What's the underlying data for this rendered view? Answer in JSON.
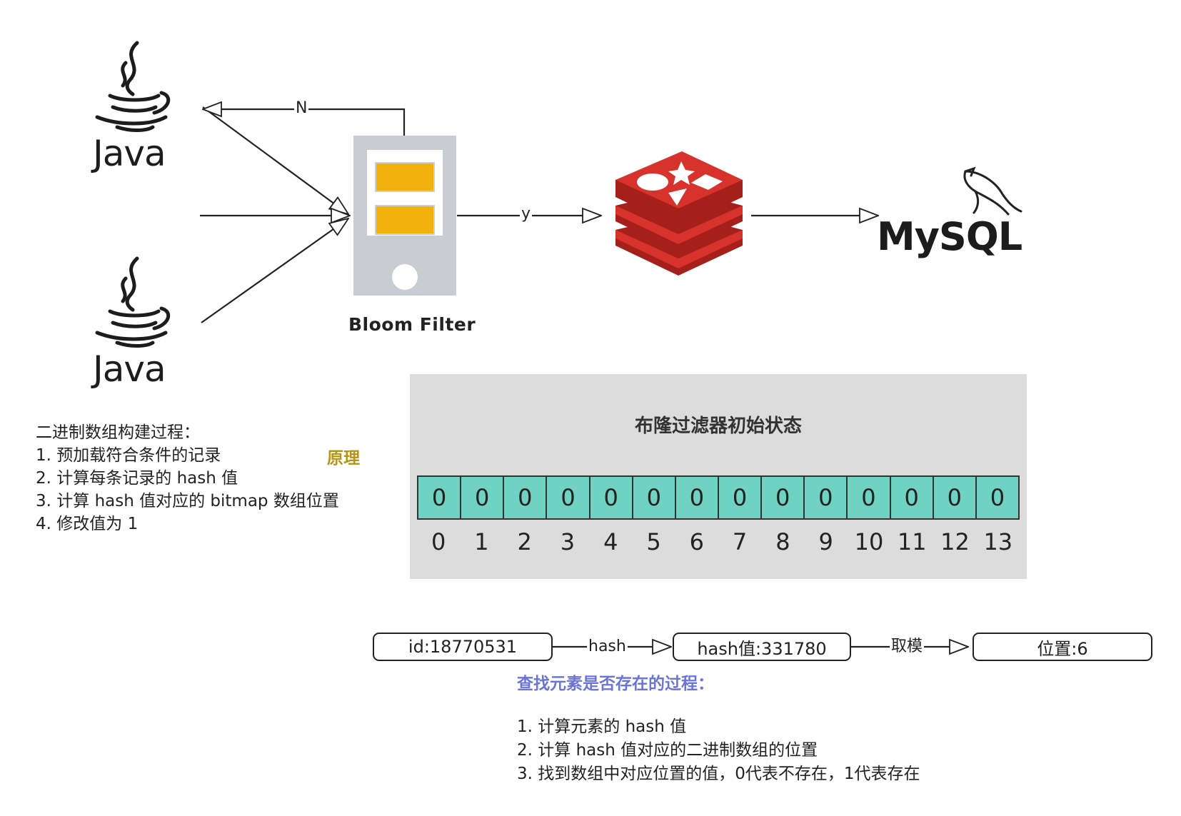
{
  "nodes": {
    "java_top": {
      "label": "Java"
    },
    "java_bottom": {
      "label": "Java"
    },
    "bloom_filter": {
      "label": "Bloom Filter"
    },
    "mysql": {
      "label": "MySQL"
    }
  },
  "edges": {
    "bloom_to_client": {
      "label": "N"
    },
    "bloom_to_redis": {
      "label": "y"
    }
  },
  "build_process": {
    "title": "二进制数组构建过程：",
    "steps": [
      "1. 预加载符合条件的记录",
      "2. 计算每条记录的 hash 值",
      "3. 计算 hash 值对应的 bitmap 数组位置",
      "4.  修改值为 1"
    ],
    "tag": "原理"
  },
  "bloom_state": {
    "title": "布隆过滤器初始状态",
    "bits": [
      "0",
      "0",
      "0",
      "0",
      "0",
      "0",
      "0",
      "0",
      "0",
      "0",
      "0",
      "0",
      "0",
      "0"
    ],
    "indices": [
      "0",
      "1",
      "2",
      "3",
      "4",
      "5",
      "6",
      "7",
      "8",
      "9",
      "10",
      "11",
      "12",
      "13"
    ]
  },
  "lookup_flow": {
    "input": "id:18770531",
    "op1": "hash",
    "hash_value": "hash值:331780",
    "op2": "取模",
    "position": "位置:6"
  },
  "lookup_process": {
    "title": "查找元素是否存在的过程：",
    "steps": [
      "1. 计算元素的 hash 值",
      "2. 计算 hash 值对应的二进制数组的位置",
      "3. 找到数组中对应位置的值，0代表不存在，1代表存在"
    ]
  },
  "colors": {
    "bit_cell": "#6fd2c2",
    "panel_bg": "#dcdcdc",
    "filter_slot": "#f2b10c",
    "redis_red": "#d7322b",
    "principle_text": "#b69416",
    "lookup_title": "#6b74d8"
  }
}
